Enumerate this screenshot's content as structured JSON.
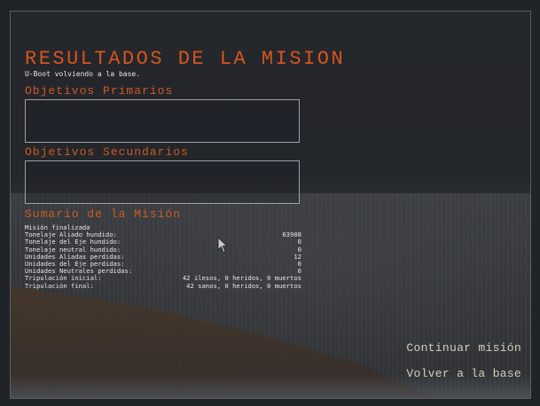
{
  "header": {
    "title": "RESULTADOS DE LA MISION",
    "subtitle": "U-Boot volviendo a la base."
  },
  "objectives": {
    "primary_label": "Objetivos Primarios",
    "secondary_label": "Objetivos Secundarios"
  },
  "summary": {
    "label": "Sumario de la Misión",
    "status": "Misión finalizada",
    "rows": [
      {
        "label": "Tonelaje Aliado hundido:",
        "value": "63908"
      },
      {
        "label": "Tonelaje del Eje hundido:",
        "value": "0"
      },
      {
        "label": "Tonelaje neutral hundido:",
        "value": "0"
      },
      {
        "label": "Unidades Aliadas perdidas:",
        "value": "12"
      },
      {
        "label": "Unidades del Eje perdidas:",
        "value": "0"
      },
      {
        "label": "Unidades Neutrales perdidas:",
        "value": "0"
      },
      {
        "label": "Tripulación inicial:",
        "value": "42 ilesos,  0 heridos,  0 muertos"
      },
      {
        "label": "Tripulación final:",
        "value": "42 sanos,  0 heridos,  0 muertos"
      }
    ]
  },
  "menu": {
    "continue_label": "Continuar misión",
    "return_label": "Volver a la base"
  },
  "colors": {
    "accent": "#d9541e",
    "text": "#e6e6e6",
    "menu_text": "#d4cfc2",
    "box_border": "#9ea3a8"
  },
  "icons": {
    "cursor": "mouse-pointer-icon"
  }
}
